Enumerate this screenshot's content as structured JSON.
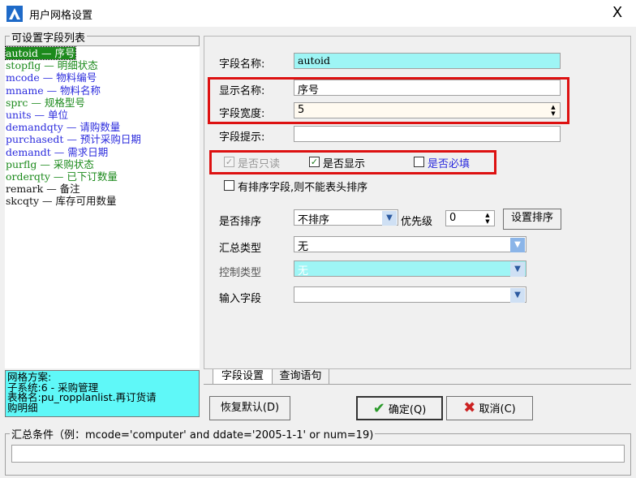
{
  "window": {
    "title": "用户网格设置",
    "close": "X"
  },
  "left": {
    "caption": "可设置字段列表",
    "fields": [
      {
        "text": "autoid — 序号",
        "color": "#1c8a1c",
        "selected": true
      },
      {
        "text": "stopflg — 明细状态",
        "color": "#1c8a1c"
      },
      {
        "text": "mcode — 物料编号",
        "color": "#2b2bdd"
      },
      {
        "text": "mname — 物料名称",
        "color": "#2b2bdd"
      },
      {
        "text": "sprc — 规格型号",
        "color": "#1c8a1c"
      },
      {
        "text": "units — 单位",
        "color": "#2b2bdd"
      },
      {
        "text": "demandqty — 请购数量",
        "color": "#2b2bdd"
      },
      {
        "text": "purchasedt — 预计采购日期",
        "color": "#2b2bdd"
      },
      {
        "text": "demandt — 需求日期",
        "color": "#2b2bdd"
      },
      {
        "text": "purflg — 采购状态",
        "color": "#1c8a1c"
      },
      {
        "text": "orderqty — 已下订数量",
        "color": "#1c8a1c"
      },
      {
        "text": "remark — 备注",
        "color": "#111111"
      },
      {
        "text": "skcqty — 库存可用数量",
        "color": "#111111"
      }
    ],
    "info": [
      "网格方案:",
      "子系统:6 - 采购管理",
      "表格名:pu_ropplanlist.再订货请",
      "购明细"
    ]
  },
  "form": {
    "field_name_label": "字段名称:",
    "field_name_value": "autoid",
    "display_name_label": "显示名称:",
    "display_name_value": "序号",
    "field_width_label": "字段宽度:",
    "field_width_value": "5",
    "field_hint_label": "字段提示:",
    "field_hint_value": "",
    "readonly_label": "是否只读",
    "show_label": "是否显示",
    "required_label": "是否必填",
    "sort_field_label": "有排序字段,则不能表头排序",
    "sort_label": "是否排序",
    "sort_value": "不排序",
    "priority_label": "优先级",
    "priority_value": "0",
    "set_sort_button": "设置排序",
    "summary_type_label": "汇总类型",
    "summary_type_value": "无",
    "control_type_label": "控制类型",
    "control_type_value": "无",
    "input_field_label": "输入字段",
    "input_field_value": "",
    "check_mark": "✓"
  },
  "tabs": [
    {
      "label": "字段设置",
      "active": true
    },
    {
      "label": "查询语句",
      "active": false
    }
  ],
  "buttons": {
    "restore_default": "恢复默认(D)",
    "ok": "确定(Q)",
    "cancel": "取消(C)"
  },
  "bottom": {
    "caption": "汇总条件（例：mcode='computer' and ddate='2005-1-1' or num=19)",
    "value": ""
  },
  "colors": {
    "accent_cyan": "#5ff8f8",
    "highlight_red": "#dd1111",
    "green_text": "#1c8a1c",
    "blue_text": "#2b2bdd"
  }
}
